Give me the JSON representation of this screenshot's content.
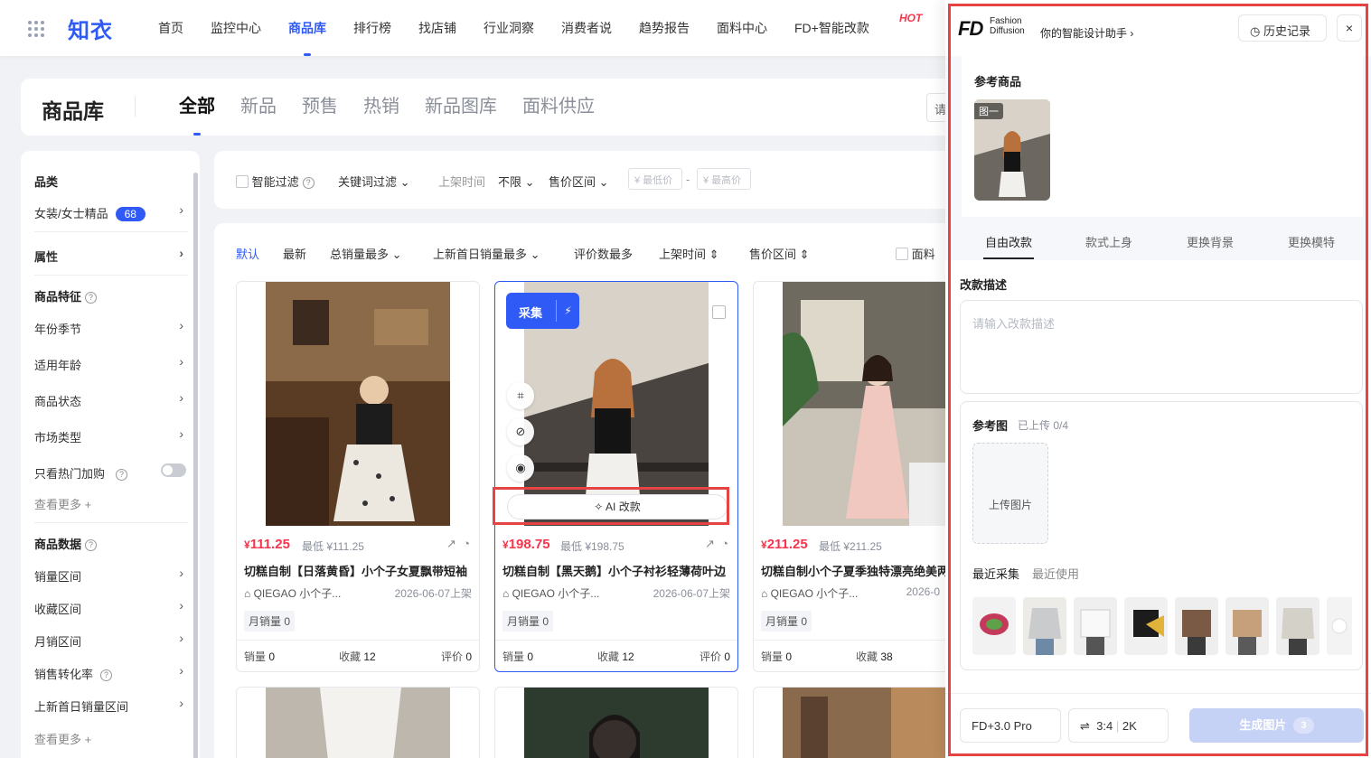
{
  "topbar": {
    "logo": "知衣",
    "nav": [
      "首页",
      "监控中心",
      "商品库",
      "排行榜",
      "找店铺",
      "行业洞察",
      "消费者说",
      "趋势报告",
      "面料中心",
      "FD+智能改款"
    ],
    "active_nav": "商品库",
    "hot_badge": "HOT"
  },
  "header": {
    "title": "商品库",
    "tabs": [
      "全部",
      "新品",
      "预售",
      "热销",
      "新品图库",
      "面料供应"
    ],
    "active_tab": "全部",
    "search_stub": "请"
  },
  "sidebar": {
    "category_title": "品类",
    "category_value": "女装/女士精品",
    "category_count": "68",
    "attribute_title": "属性",
    "features_title": "商品特征",
    "features": [
      "年份季节",
      "适用年龄",
      "商品状态",
      "市场类型"
    ],
    "hot_only": "只看热门加购",
    "see_more": "查看更多",
    "data_title": "商品数据",
    "data_items": [
      "销量区间",
      "收藏区间",
      "月销区间",
      "销售转化率",
      "上新首日销量区间"
    ],
    "see_more_2": "查看更多"
  },
  "filters": {
    "smart": "智能过滤",
    "keyword": "关键词过滤",
    "listing_time": "上架时间",
    "listing_value": "不限",
    "price_range": "售价区间",
    "min_placeholder": "¥ 最低价",
    "max_placeholder": "¥ 最高价",
    "dash": "-"
  },
  "sort": {
    "items": [
      "默认",
      "最新",
      "总销量最多",
      "上新首日销量最多",
      "评价数最多",
      "上架时间",
      "售价区间"
    ],
    "active": "默认",
    "fabric": "面料"
  },
  "products": [
    {
      "price": "111.25",
      "lowest": "最低 ¥111.25",
      "title": "切糕自制【日落黄昏】小个子女夏飘带短袖",
      "shop": "QIEGAO 小个子...",
      "date": "2026-06-07上架",
      "monthly": "月销量 0",
      "sales_label": "销量",
      "sales": "0",
      "fav_label": "收藏",
      "fav": "12",
      "review_label": "评价",
      "review": "0"
    },
    {
      "price": "198.75",
      "lowest": "最低 ¥198.75",
      "title": "切糕自制【黑天鹅】小个子衬衫轻薄荷叶边",
      "shop": "QIEGAO 小个子...",
      "date": "2026-06-07上架",
      "monthly": "月销量 0",
      "sales_label": "销量",
      "sales": "0",
      "fav_label": "收藏",
      "fav": "12",
      "review_label": "评价",
      "review": "0"
    },
    {
      "price": "211.25",
      "lowest": "最低 ¥211.25",
      "title": "切糕自制小个子夏季独特漂亮绝美两",
      "shop": "QIEGAO 小个子...",
      "date": "2026-0",
      "monthly": "月销量 0",
      "sales_label": "销量",
      "sales": "0",
      "fav_label": "收藏",
      "fav": "38",
      "review_label": "评价",
      "review": "0"
    }
  ],
  "card_overlay": {
    "collect": "采集",
    "ai_edit": "AI 改款"
  },
  "panel": {
    "brand_mark": "FD",
    "brand_line1": "Fashion",
    "brand_line2": "Diffusion",
    "slogan": "你的智能设计助手 ›",
    "history": "历史记录",
    "close": "×",
    "ref_title": "参考商品",
    "ref_tag": "图一",
    "modes": [
      "自由改款",
      "款式上身",
      "更换背景",
      "更换模特"
    ],
    "active_mode": "自由改款",
    "desc_label": "改款描述",
    "desc_placeholder": "请输入改款描述",
    "refimg_title": "参考图",
    "refimg_count": "已上传 0/4",
    "upload": "上传图片",
    "recent_tabs": [
      "最近采集",
      "最近使用"
    ],
    "model": "FD+3.0 Pro",
    "ratio": "3:4",
    "resolution": "2K",
    "generate": "生成图片",
    "generate_count": "3"
  },
  "colors": {
    "brand": "#2f5af5",
    "price": "#f5354c",
    "highlight": "#e64444"
  }
}
